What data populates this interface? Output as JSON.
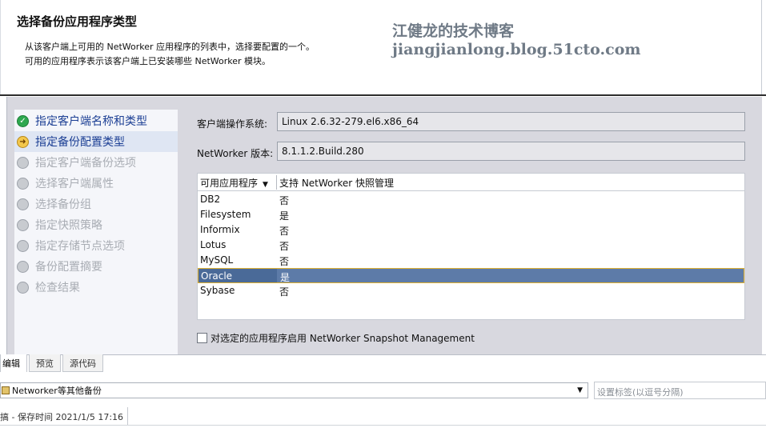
{
  "header": {
    "title": "选择备份应用程序类型",
    "desc_line1": "从该客户端上可用的 NetWorker 应用程序的列表中，选择要配置的一个。",
    "desc_line2": "可用的应用程序表示该客户端上已安装哪些 NetWorker 模块。",
    "watermark": "江健龙的技术博客 jiangjianlong.blog.51cto.com"
  },
  "steps": [
    {
      "label": "指定客户端名称和类型",
      "state": "done"
    },
    {
      "label": "指定备份配置类型",
      "state": "current"
    },
    {
      "label": "指定客户端备份选项",
      "state": "pending"
    },
    {
      "label": "选择客户端属性",
      "state": "pending"
    },
    {
      "label": "选择备份组",
      "state": "pending"
    },
    {
      "label": "指定快照策略",
      "state": "pending"
    },
    {
      "label": "指定存储节点选项",
      "state": "pending"
    },
    {
      "label": "备份配置摘要",
      "state": "pending"
    },
    {
      "label": "检查结果",
      "state": "pending"
    }
  ],
  "fields": {
    "os_label": "客户端操作系统:",
    "os_value": "Linux 2.6.32-279.el6.x86_64",
    "version_label": "NetWorker 版本:",
    "version_value": "8.1.1.2.Build.280"
  },
  "table": {
    "col1": "可用应用程序",
    "col2": "支持 NetWorker 快照管理",
    "sort_arrow": "▼",
    "rows": [
      {
        "app": "DB2",
        "snap": "否"
      },
      {
        "app": "Filesystem",
        "snap": "是"
      },
      {
        "app": "Informix",
        "snap": "否"
      },
      {
        "app": "Lotus",
        "snap": "否"
      },
      {
        "app": "MySQL",
        "snap": "否"
      },
      {
        "app": "Oracle",
        "snap": "是"
      },
      {
        "app": "Sybase",
        "snap": "否"
      }
    ],
    "selected_index": 5
  },
  "snapshot_checkbox": {
    "label": "对选定的应用程序启用 NetWorker Snapshot Management",
    "checked": false
  },
  "editor": {
    "tabs": [
      "编辑",
      "预览",
      "源代码"
    ],
    "active_tab": 0,
    "category_value": "Networker等其他备份",
    "tag_placeholder": "设置标签(以逗号分隔)",
    "status": "搞 - 保存时间 2021/1/5 17:16"
  },
  "colors": {
    "step_done": "#2fa84f",
    "step_current": "#f3c74b",
    "step_pending": "#c8cbd0",
    "selected_row": "#5d7ba8",
    "panel_bg": "#d8d8df"
  },
  "icons": {
    "step_done": "check-circle-icon",
    "step_current": "arrow-circle-icon",
    "step_pending": "pending-circle-icon",
    "select_dropdown": "chevron-down-icon"
  }
}
